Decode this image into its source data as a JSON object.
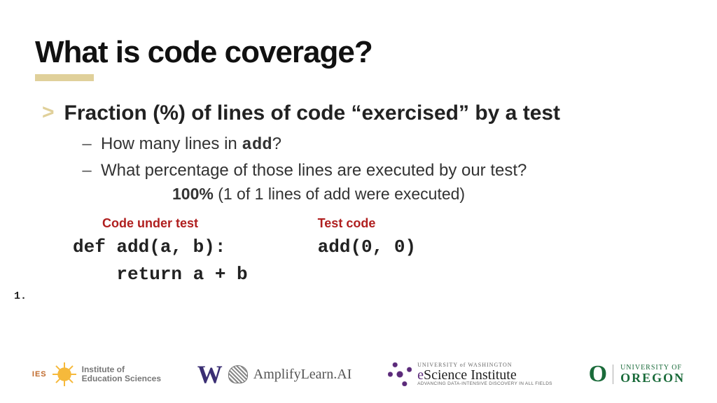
{
  "title": "What is code coverage?",
  "bullet": "Fraction (%) of lines of code “exercised” by a test",
  "sub1_pre": "How many lines in ",
  "sub1_code": "add",
  "sub1_post": "?",
  "sub2": "What percentage of those lines are executed by our test?",
  "answer_pct": "100%",
  "answer_rest": " (1 of 1 lines of add were executed)",
  "code_under_test_label": "Code under test",
  "test_code_label": "Test code",
  "code_under_test": "def add(a, b):\n    return a + b",
  "test_code": "add(0, 0)",
  "line_num": "1.",
  "logos": {
    "ies_small": "IES",
    "ies_line1": "Institute of",
    "ies_line2": "Education Sciences",
    "uw": "W",
    "amplify": "AmplifyLearn.AI",
    "esci_u": "UNIVERSITY of WASHINGTON",
    "esci_m1": "e",
    "esci_m2": "Science ",
    "esci_m3": "Institute",
    "esci_s": "ADVANCING DATA-INTENSIVE DISCOVERY IN ALL FIELDS",
    "uo_o": "O",
    "uo_u": "UNIVERSITY OF",
    "uo_m": "OREGON"
  }
}
